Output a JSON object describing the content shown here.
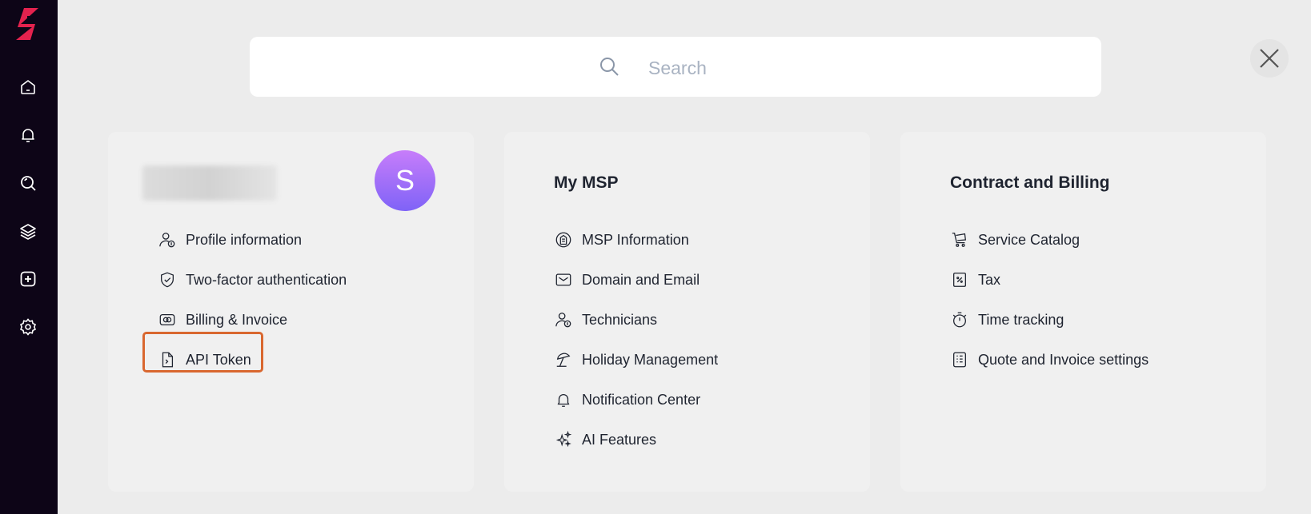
{
  "search": {
    "placeholder": "Search",
    "value": ""
  },
  "profile_card": {
    "avatar_initial": "S",
    "items": [
      {
        "label": "Profile information",
        "icon": "user-settings-icon"
      },
      {
        "label": "Two-factor authentication",
        "icon": "shield-check-icon"
      },
      {
        "label": "Billing & Invoice",
        "icon": "billing-icon"
      },
      {
        "label": "API Token",
        "icon": "file-code-icon"
      }
    ],
    "highlighted_item": "API Token"
  },
  "msp_card": {
    "title": "My MSP",
    "items": [
      {
        "label": "MSP Information",
        "icon": "building-icon"
      },
      {
        "label": "Domain and Email",
        "icon": "envelope-icon"
      },
      {
        "label": "Technicians",
        "icon": "user-settings-icon"
      },
      {
        "label": "Holiday Management",
        "icon": "beach-umbrella-icon"
      },
      {
        "label": "Notification Center",
        "icon": "bell-icon"
      },
      {
        "label": "AI Features",
        "icon": "sparkles-icon"
      }
    ]
  },
  "billing_card": {
    "title": "Contract and Billing",
    "items": [
      {
        "label": "Service Catalog",
        "icon": "cart-icon"
      },
      {
        "label": "Tax",
        "icon": "tax-icon"
      },
      {
        "label": "Time tracking",
        "icon": "stopwatch-icon"
      },
      {
        "label": "Quote and Invoice settings",
        "icon": "invoice-icon"
      }
    ]
  },
  "sidebar": {
    "items": [
      "home-icon",
      "bell-icon",
      "search-icon",
      "layers-icon",
      "add-icon",
      "gear-icon"
    ]
  },
  "colors": {
    "sidebar_bg": "#0d0517",
    "brand": "#e4224e",
    "highlight": "#d9672f",
    "avatar_from": "#c77dfa",
    "avatar_to": "#7f63f7"
  }
}
